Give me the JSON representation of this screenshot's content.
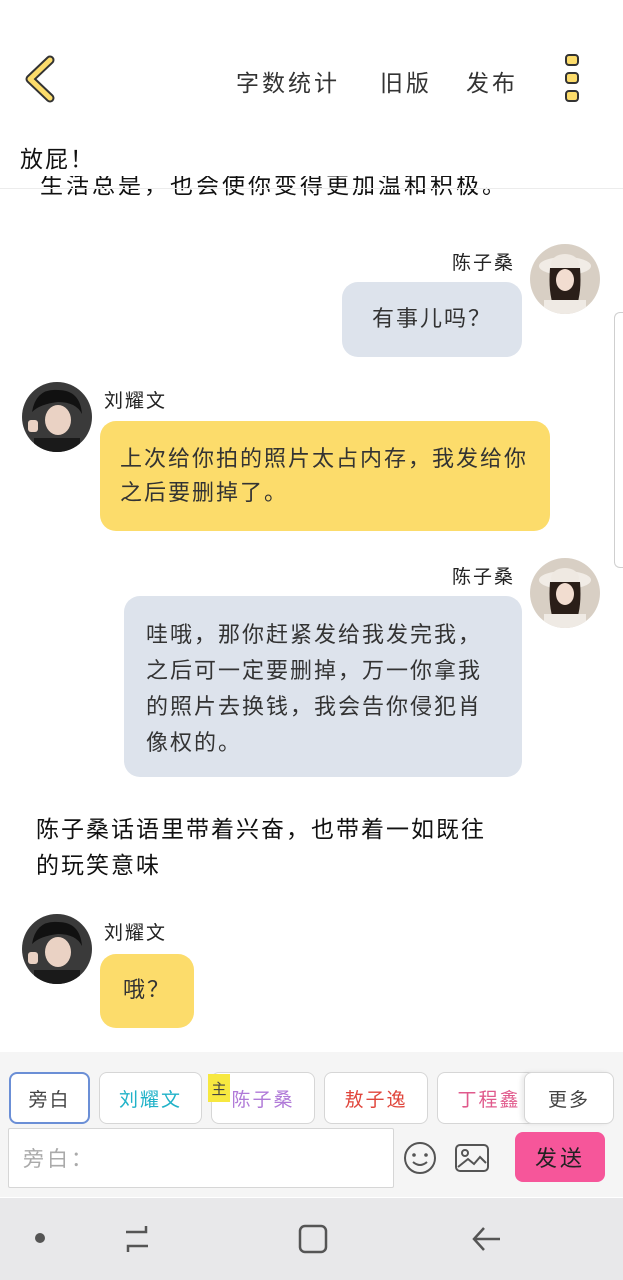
{
  "header": {
    "word_count": "字数统计",
    "old_version": "旧版",
    "publish": "发布"
  },
  "story_title": "放屁！",
  "cut_off_line": "生活总是，也会使你变得更加温和积极。",
  "messages": [
    {
      "side": "right",
      "name": "陈子桑",
      "text": "有事儿吗？"
    },
    {
      "side": "left",
      "name": "刘耀文",
      "text": "上次给你拍的照片太占内存，我发给你之后要删掉了。"
    },
    {
      "side": "right",
      "name": "陈子桑",
      "text": "哇哦，那你赶紧发给我发完我，之后可一定要删掉，万一你拿我的照片去换钱，我会告你侵犯肖像权的。"
    },
    {
      "side": "left",
      "name": "刘耀文",
      "text": "哦？"
    }
  ],
  "narration": "陈子桑话语里带着兴奋，也带着一如既往的玩笑意味",
  "roles": [
    {
      "label": "旁白",
      "color": "#444444"
    },
    {
      "label": "刘耀文",
      "color": "#20b2c8"
    },
    {
      "label": "陈子桑",
      "color": "#b07ad8"
    },
    {
      "label": "敖子逸",
      "color": "#e0463c"
    },
    {
      "label": "丁程鑫",
      "color": "#e05a8c"
    },
    {
      "label": "更多",
      "color": "#444444"
    }
  ],
  "host_badge": "主",
  "input": {
    "placeholder": "旁白："
  },
  "send_label": "发送",
  "colors": {
    "accent_yellow": "#fcdc6b",
    "right_bubble": "#dde3ec",
    "send_pink": "#f6569a"
  }
}
